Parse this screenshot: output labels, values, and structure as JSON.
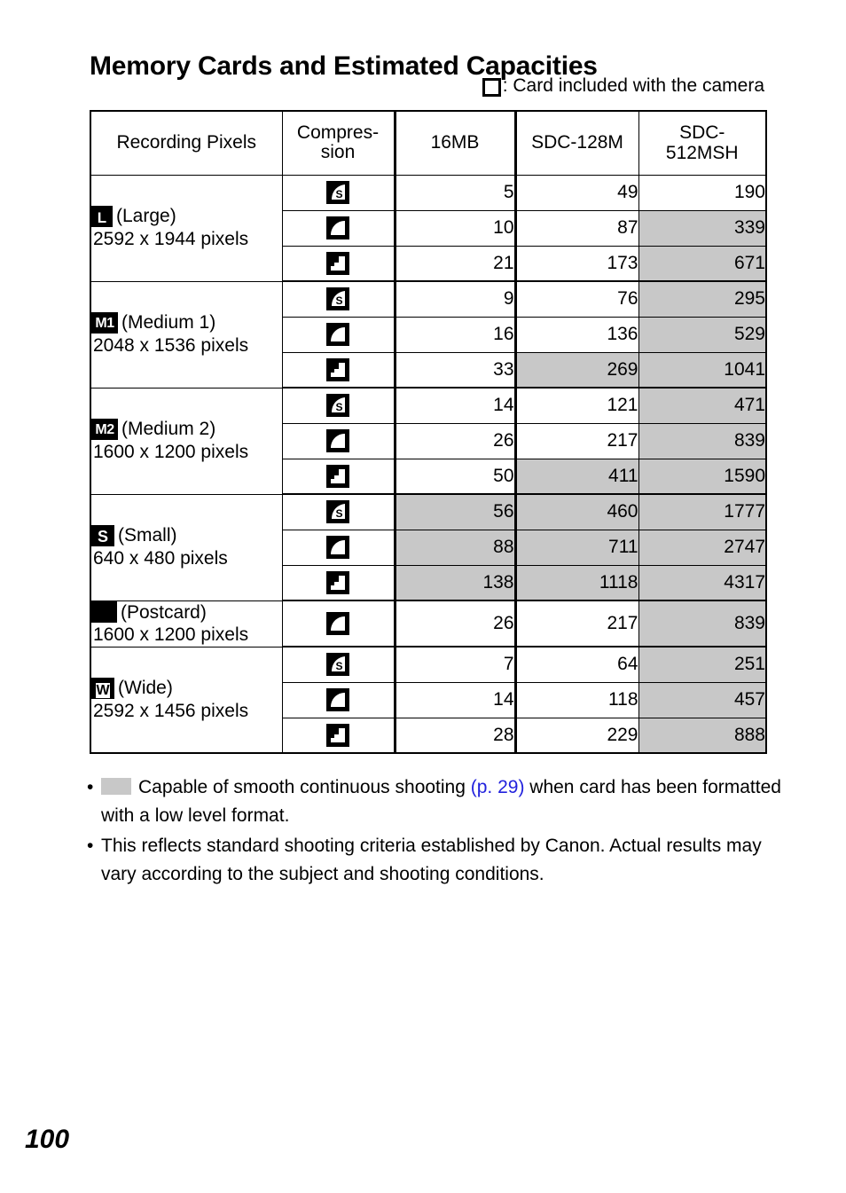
{
  "document": {
    "title": "Memory Cards and Estimated Capacities",
    "page_number": "100"
  },
  "card_note": {
    "icon": "empty-square-icon",
    "text": ": Card included with the camera"
  },
  "table": {
    "headers": {
      "recording_pixels": "Recording Pixels",
      "compression": "Compres-\nsion",
      "compression_line1": "Compres-",
      "compression_line2": "sion",
      "col_16mb": "16MB",
      "col_sdc128m": "SDC-128M",
      "col_sdc512msh_line1": "SDC-",
      "col_sdc512msh_line2": "512MSH"
    },
    "highlighted_column": "16MB",
    "shade_color": "#c8c8c8",
    "groups": [
      {
        "badge": "L",
        "badge_type": "letter",
        "label": "(Large)",
        "dimensions": "2592 x 1944 pixels",
        "rows": [
          {
            "compression": "superfine",
            "values": [
              "5",
              "49",
              "190"
            ],
            "shaded": [
              false,
              false,
              false
            ]
          },
          {
            "compression": "fine",
            "values": [
              "10",
              "87",
              "339"
            ],
            "shaded": [
              false,
              false,
              true
            ]
          },
          {
            "compression": "normal",
            "values": [
              "21",
              "173",
              "671"
            ],
            "shaded": [
              false,
              false,
              true
            ]
          }
        ]
      },
      {
        "badge": "M1",
        "badge_type": "letter",
        "label": "(Medium 1)",
        "dimensions": "2048 x 1536 pixels",
        "rows": [
          {
            "compression": "superfine",
            "values": [
              "9",
              "76",
              "295"
            ],
            "shaded": [
              false,
              false,
              true
            ]
          },
          {
            "compression": "fine",
            "values": [
              "16",
              "136",
              "529"
            ],
            "shaded": [
              false,
              false,
              true
            ]
          },
          {
            "compression": "normal",
            "values": [
              "33",
              "269",
              "1041"
            ],
            "shaded": [
              false,
              true,
              true
            ]
          }
        ]
      },
      {
        "badge": "M2",
        "badge_type": "letter",
        "label": "(Medium 2)",
        "dimensions": "1600 x 1200 pixels",
        "rows": [
          {
            "compression": "superfine",
            "values": [
              "14",
              "121",
              "471"
            ],
            "shaded": [
              false,
              false,
              true
            ]
          },
          {
            "compression": "fine",
            "values": [
              "26",
              "217",
              "839"
            ],
            "shaded": [
              false,
              false,
              true
            ]
          },
          {
            "compression": "normal",
            "values": [
              "50",
              "411",
              "1590"
            ],
            "shaded": [
              false,
              true,
              true
            ]
          }
        ]
      },
      {
        "badge": "S",
        "badge_type": "letter",
        "label": "(Small)",
        "dimensions": "640 x 480 pixels",
        "rows": [
          {
            "compression": "superfine",
            "values": [
              "56",
              "460",
              "1777"
            ],
            "shaded": [
              true,
              true,
              true
            ]
          },
          {
            "compression": "fine",
            "values": [
              "88",
              "711",
              "2747"
            ],
            "shaded": [
              true,
              true,
              true
            ]
          },
          {
            "compression": "normal",
            "values": [
              "138",
              "1118",
              "4317"
            ],
            "shaded": [
              true,
              true,
              true
            ]
          }
        ]
      },
      {
        "badge": "postcard",
        "badge_type": "postcard",
        "label": "(Postcard)",
        "dimensions": "1600 x 1200 pixels",
        "rows": [
          {
            "compression": "fine",
            "values": [
              "26",
              "217",
              "839"
            ],
            "shaded": [
              false,
              false,
              true
            ]
          }
        ]
      },
      {
        "badge": "W",
        "badge_type": "outlined-letter",
        "label": "(Wide)",
        "dimensions": "2592 x 1456 pixels",
        "rows": [
          {
            "compression": "superfine",
            "values": [
              "7",
              "64",
              "251"
            ],
            "shaded": [
              false,
              false,
              true
            ]
          },
          {
            "compression": "fine",
            "values": [
              "14",
              "118",
              "457"
            ],
            "shaded": [
              false,
              false,
              true
            ]
          },
          {
            "compression": "normal",
            "values": [
              "28",
              "229",
              "888"
            ],
            "shaded": [
              false,
              false,
              true
            ]
          }
        ]
      }
    ]
  },
  "notes": [
    {
      "bullet": "•",
      "has_swatch": true,
      "text_before": "Capable of smooth continuous shooting ",
      "xref": "(p. 29)",
      "text_after": " when card has been formatted with a low level format."
    },
    {
      "bullet": "•",
      "has_swatch": false,
      "text_before": "This reflects standard shooting criteria established by Canon. Actual results may vary according to the subject and shooting conditions.",
      "xref": "",
      "text_after": ""
    }
  ]
}
